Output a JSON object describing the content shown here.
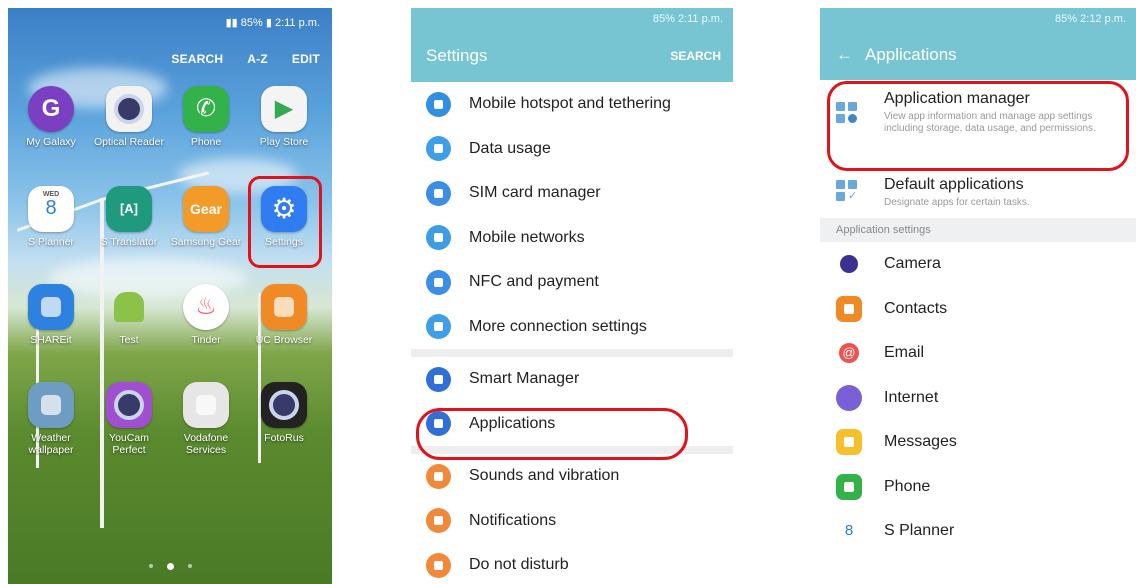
{
  "home": {
    "status": "2:11 p.m.",
    "battery": "85%",
    "topbar": [
      "SEARCH",
      "A-Z",
      "EDIT"
    ],
    "apps": [
      {
        "label": "My Galaxy",
        "icon": "galaxy-icon",
        "color": "#7b3fc1"
      },
      {
        "label": "Optical Reader",
        "icon": "camera-t-icon",
        "color": "#f2f2f2"
      },
      {
        "label": "Phone",
        "icon": "phone-icon",
        "color": "#33b249"
      },
      {
        "label": "Play Store",
        "icon": "play-store-icon",
        "color": "#f4f4f4"
      },
      {
        "label": "WED 8",
        "dayname": "WED",
        "day": "8",
        "appname": "S Planner",
        "icon": "calendar-icon",
        "color": "#ffffff"
      },
      {
        "label": "S Translator",
        "glyph": "[A]",
        "icon": "translator-icon",
        "color": "#1f9a7e"
      },
      {
        "label": "Samsung Gear",
        "glyph": "Gear",
        "icon": "gear-brand-icon",
        "color": "#f39b28"
      },
      {
        "label": "Settings",
        "icon": "settings-gear-icon",
        "color": "#2f7df0"
      },
      {
        "label": "SHAREit",
        "icon": "shareit-icon",
        "color": "#2d82e0"
      },
      {
        "label": "Test",
        "icon": "android-icon",
        "color": "#8bc34a"
      },
      {
        "label": "Tinder",
        "icon": "flame-icon",
        "color": "#ffffff"
      },
      {
        "label": "UC Browser",
        "icon": "uc-browser-icon",
        "color": "#f08a24"
      },
      {
        "label": "Weather wallpaper",
        "icon": "weather-icon",
        "color": "#6f9cc2"
      },
      {
        "label": "YouCam Perfect",
        "icon": "youcam-icon",
        "color": "#a04fd0"
      },
      {
        "label": "Vodafone Services",
        "icon": "vodafone-icon",
        "color": "#e6e6e6"
      },
      {
        "label": "FotoRus",
        "icon": "fotorus-icon",
        "color": "#222222"
      }
    ]
  },
  "settings": {
    "status": "2:11 p.m.",
    "battery": "85%",
    "title": "Settings",
    "search": "SEARCH",
    "groups": [
      [
        {
          "label": "Mobile hotspot and tethering",
          "color": "#2f8fe0"
        },
        {
          "label": "Data usage",
          "color": "#3f9ee8"
        },
        {
          "label": "SIM card manager",
          "color": "#3a8ee3"
        },
        {
          "label": "Mobile networks",
          "color": "#3e9be6"
        },
        {
          "label": "NFC and payment",
          "color": "#3a8ee3"
        },
        {
          "label": "More connection settings",
          "color": "#3f9ee8"
        }
      ],
      [
        {
          "label": "Smart Manager",
          "color": "#2f6fd6"
        },
        {
          "label": "Applications",
          "color": "#2f6fd6"
        }
      ],
      [
        {
          "label": "Sounds and vibration",
          "color": "#f08a3a"
        },
        {
          "label": "Notifications",
          "color": "#f08a3a"
        },
        {
          "label": "Do not disturb",
          "color": "#f08a3a"
        }
      ]
    ]
  },
  "applications": {
    "status": "2:12 p.m.",
    "battery": "85%",
    "title": "Applications",
    "manager_title": "Application manager",
    "manager_desc": "View app information and manage app settings including storage, data usage, and permissions.",
    "default_title": "Default applications",
    "default_desc": "Designate apps for certain tasks.",
    "section": "Application settings",
    "items": [
      {
        "label": "Camera",
        "color": "#ffffff",
        "icon": "camera-lens-icon"
      },
      {
        "label": "Contacts",
        "color": "#f08a24",
        "icon": "contacts-icon"
      },
      {
        "label": "Email",
        "color": "#ffffff",
        "icon": "email-icon"
      },
      {
        "label": "Internet",
        "color": "#7b5fd6",
        "icon": "internet-icon"
      },
      {
        "label": "Messages",
        "color": "#f6c02c",
        "icon": "messages-icon"
      },
      {
        "label": "Phone",
        "color": "#33b249",
        "icon": "phone-icon"
      },
      {
        "label": "S Planner",
        "color": "#ffffff",
        "icon": "calendar-icon",
        "day": "8"
      }
    ]
  }
}
